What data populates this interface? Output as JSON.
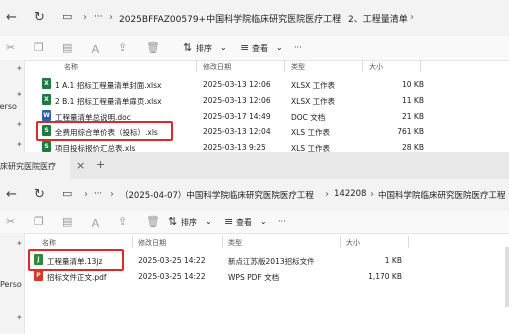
{
  "window1": {
    "breadcrumb": [
      "2025BFFAZ00579+中国科学院临床研究医院医疗工程",
      "2、工程量清单"
    ],
    "more": "···",
    "toolbar": {
      "sort": "排序",
      "view": "查看",
      "more": "···"
    },
    "side_label": "· Perso",
    "columns": {
      "name": "名称",
      "modified": "修改日期",
      "type": "类型",
      "size": "大小"
    },
    "files": [
      {
        "name": "1 A.1 招标工程量清单封面.xlsx",
        "date": "2025-03-13 12:06",
        "type": "XLSX 工作表",
        "size": "10 KB",
        "icon": "xlsx-icon"
      },
      {
        "name": "2 B.1 招标工程量清单扉页.xlsx",
        "date": "2025-03-13 12:06",
        "type": "XLSX 工作表",
        "size": "11 KB",
        "icon": "xlsx-icon"
      },
      {
        "name": "工程量清单总说明.doc",
        "date": "2025-03-17 14:49",
        "type": "DOC 文档",
        "size": "21 KB",
        "icon": "doc-icon"
      },
      {
        "name": "全费用综合单价表（投标）.xls",
        "date": "2025-03-13 12:04",
        "type": "XLS 工作表",
        "size": "761 KB",
        "icon": "xls-icon"
      },
      {
        "name": "项目投标报价汇总表.xls",
        "date": "2025-03-13 9:25",
        "type": "XLS 工作表",
        "size": "28 KB",
        "icon": "xls-icon"
      }
    ]
  },
  "window2": {
    "tab_title": "床研究医院医疗",
    "tab_close": "×",
    "tab_new": "+",
    "breadcrumb": [
      "（2025-04-07）中国科学院临床研究医院医疗工程",
      "142208",
      "中国科学院临床研究医院医疗工程"
    ],
    "toolbar": {
      "sort": "排序",
      "view": "查看",
      "more": "···"
    },
    "side_label": "Perso",
    "columns": {
      "name": "名称",
      "modified": "修改日期",
      "type": "类型",
      "size": "大小"
    },
    "files": [
      {
        "name": "工程量清单.13jz",
        "date": "2025-03-25 14:22",
        "type": "新点江苏版2013招标文件",
        "size": "1 KB",
        "icon": "jz-icon"
      },
      {
        "name": "招标文件正文.pdf",
        "date": "2025-03-25 14:22",
        "type": "WPS PDF 文档",
        "size": "1,170 KB",
        "icon": "pdf-icon"
      }
    ]
  },
  "colors": {
    "highlight": "#e0282c",
    "xls": "#1f7a3f",
    "doc": "#2b5fb4",
    "pdf": "#d9352b",
    "jz": "#2e8b3a"
  }
}
